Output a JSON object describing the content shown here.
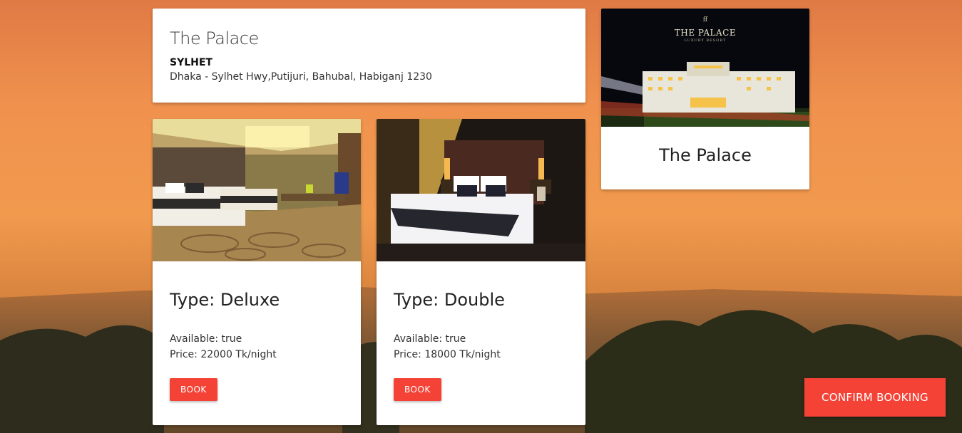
{
  "hotel": {
    "name": "The Palace",
    "city": "SYLHET",
    "address": "Dhaka - Sylhet Hwy,Putijuri, Bahubal, Habiganj 1230"
  },
  "hotel_card": {
    "title": "The Palace",
    "logo_text": "THE PALACE",
    "logo_subtext": "LUXURY RESORT"
  },
  "rooms": [
    {
      "type": "Type: Deluxe",
      "available": "Available: true",
      "price": "Price: 22000 Tk/night",
      "button": "BOOK"
    },
    {
      "type": "Type: Double",
      "available": "Available: true",
      "price": "Price: 18000 Tk/night",
      "button": "BOOK"
    }
  ],
  "confirm_button": "CONFIRM BOOKING",
  "colors": {
    "accent": "#f44336",
    "background_top": "#e07a45"
  }
}
